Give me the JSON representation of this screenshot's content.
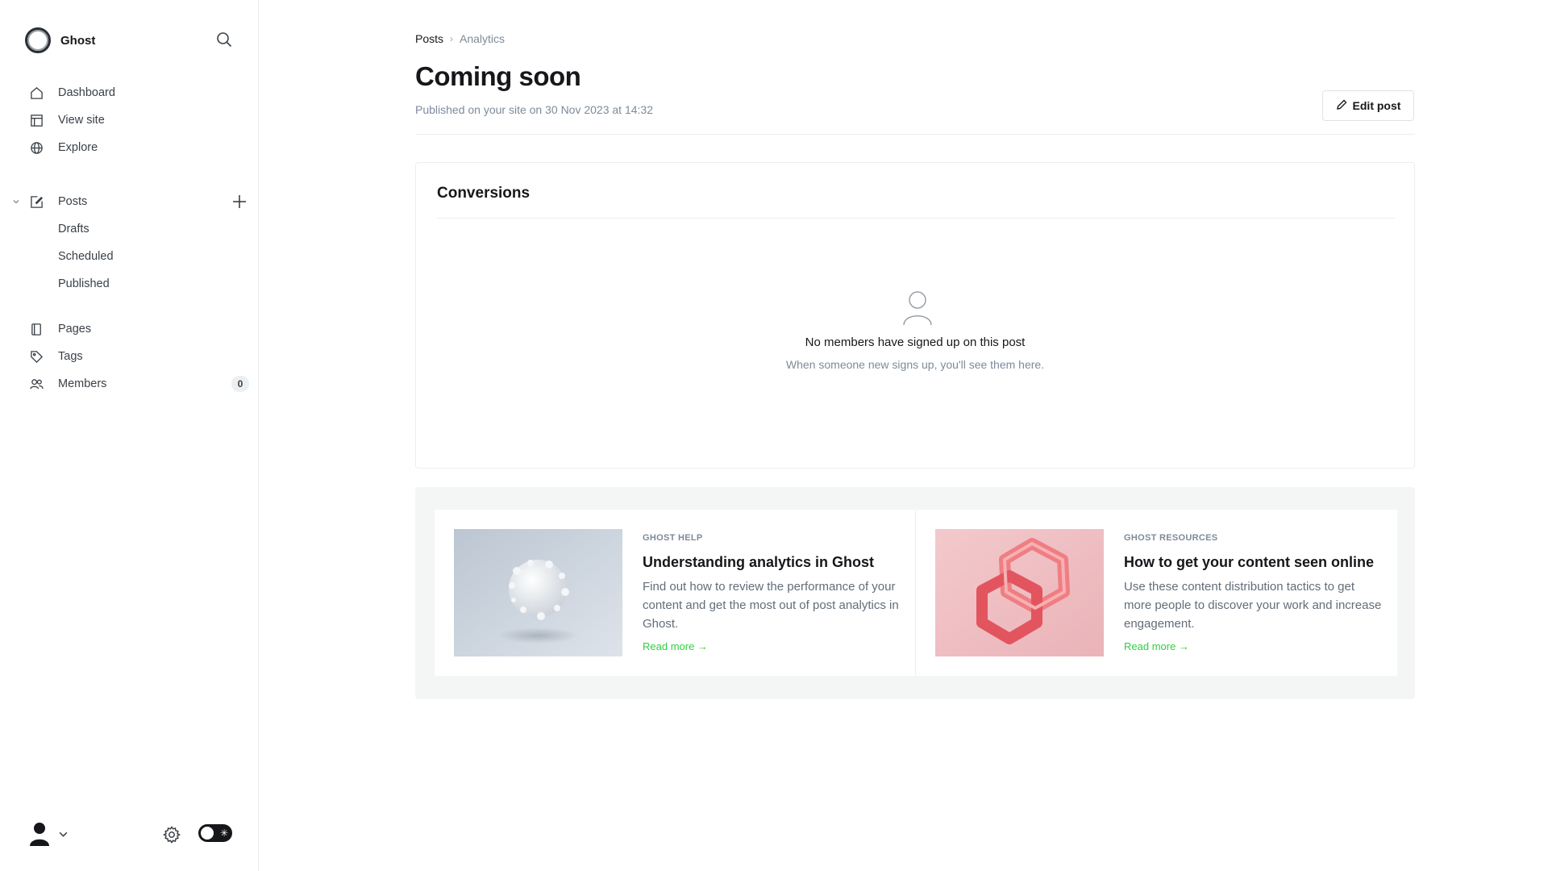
{
  "app": {
    "name": "Ghost"
  },
  "sidebar": {
    "primary": [
      {
        "label": "Dashboard",
        "icon": "home-icon"
      },
      {
        "label": "View site",
        "icon": "layout-icon"
      },
      {
        "label": "Explore",
        "icon": "globe-icon"
      }
    ],
    "posts": {
      "label": "Posts",
      "sub": [
        "Drafts",
        "Scheduled",
        "Published"
      ]
    },
    "secondary": [
      {
        "label": "Pages",
        "icon": "pages-icon"
      },
      {
        "label": "Tags",
        "icon": "tag-icon"
      },
      {
        "label": "Members",
        "icon": "members-icon",
        "count": "0"
      }
    ]
  },
  "breadcrumb": {
    "parent": "Posts",
    "current": "Analytics"
  },
  "post": {
    "title": "Coming soon",
    "published": "Published on your site on 30 Nov 2023 at 14:32",
    "edit_label": "Edit post"
  },
  "conversions": {
    "title": "Conversions",
    "empty_title": "No members have signed up on this post",
    "empty_sub": "When someone new signs up, you'll see them here."
  },
  "resources": [
    {
      "category": "GHOST HELP",
      "title": "Understanding analytics in Ghost",
      "description": "Find out how to review the performance of your content and get the most out of post analytics in Ghost.",
      "link": "Read more →"
    },
    {
      "category": "GHOST RESOURCES",
      "title": "How to get your content seen online",
      "description": "Use these content distribution tactics to get more people to discover your work and increase engagement.",
      "link": "Read more →"
    }
  ],
  "colors": {
    "accent_green": "#30cf43",
    "text": "#15171a",
    "muted": "#7c8b9a"
  }
}
